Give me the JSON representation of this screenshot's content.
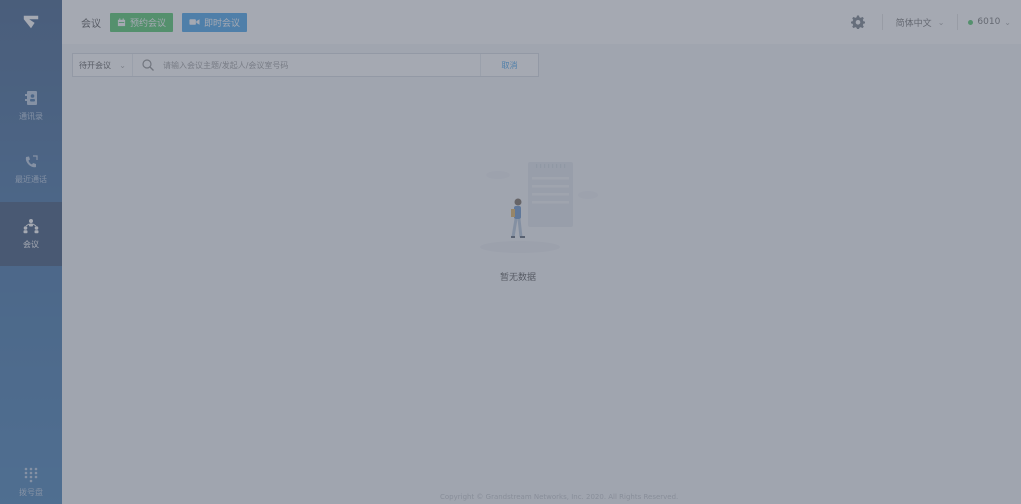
{
  "sidebar": {
    "items": [
      {
        "label": "通讯录",
        "icon": "contacts-icon"
      },
      {
        "label": "最近通话",
        "icon": "recent-calls-icon"
      },
      {
        "label": "会议",
        "icon": "meeting-icon",
        "active": true
      }
    ],
    "dialpad": {
      "label": "拨号盘",
      "icon": "dialpad-icon"
    }
  },
  "header": {
    "title": "会议",
    "schedule_button": "预约会议",
    "instant_button": "即时会议",
    "language": "简体中文",
    "account": "6010"
  },
  "search": {
    "filter": "待开会议",
    "placeholder": "请输入会议主题/发起人/会议室号码",
    "value": "",
    "cancel": "取消"
  },
  "empty_state": {
    "text": "暂无数据"
  },
  "footer": {
    "copyright": "Copyright © Grandstream Networks, Inc. 2020. All Rights Reserved."
  },
  "colors": {
    "sidebar": "#16508f",
    "green": "#2bbd4b",
    "blue": "#1e90e8",
    "overlay": "rgba(110,116,130,0.62)"
  }
}
